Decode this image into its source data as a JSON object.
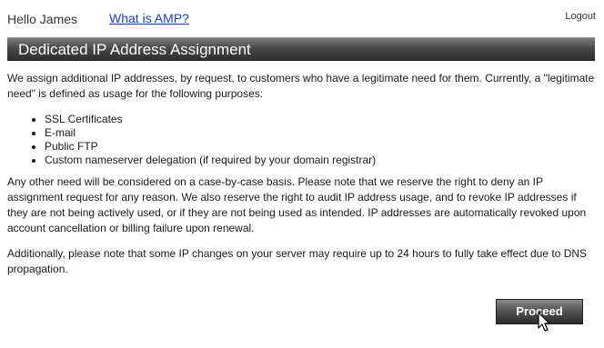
{
  "header": {
    "greeting": "Hello James",
    "amp_link": "What is AMP?",
    "logout": "Logout"
  },
  "section": {
    "title": "Dedicated IP Address Assignment"
  },
  "content": {
    "intro": "We assign additional IP addresses, by request, to customers who have a legitimate need for them. Currently, a \"legitimate need\" is defined as usage for the following purposes:",
    "purposes": [
      "SSL Certificates",
      "E-mail",
      "Public FTP",
      "Custom nameserver delegation (if required by your domain registrar)"
    ],
    "policy": "Any other need will be considered on a case-by-case basis. Please note that we reserve the right to deny an IP assignment request for any reason. We also reserve the right to audit IP address usage, and to revoke IP addresses if they are not being actively used, or if they are not being used as intended. IP addresses are automatically revoked upon account cancellation or billing failure upon renewal.",
    "note": "Additionally, please note that some IP changes on your server may require up to 24 hours to fully take effect due to DNS propagation."
  },
  "actions": {
    "proceed_label": "Proceed"
  },
  "icons": {
    "cursor": "mouse-pointer-icon"
  },
  "colors": {
    "link": "#1a3fc9",
    "title_bar": "#4a4a4a",
    "button": "#555555",
    "text": "#1a1a1a"
  }
}
